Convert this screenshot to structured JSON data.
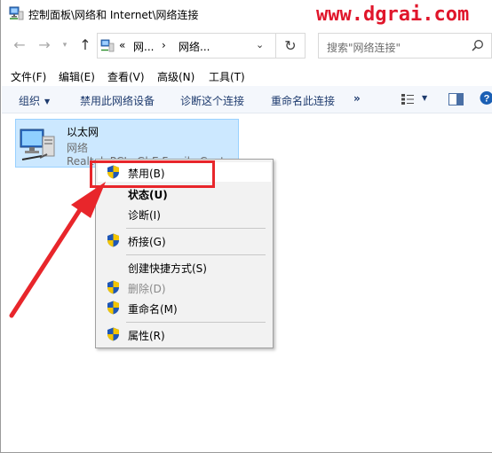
{
  "window": {
    "title": "控制面板\\网络和 Internet\\网络连接",
    "watermark": "www.dgrai.com"
  },
  "address": {
    "chevron_prefix": "«",
    "segment1": "网...",
    "separator": "›",
    "segment2": "网络...",
    "search_placeholder": "搜索\"网络连接\""
  },
  "menubar": {
    "items": [
      "文件(F)",
      "编辑(E)",
      "查看(V)",
      "高级(N)",
      "工具(T)"
    ]
  },
  "toolbar": {
    "organize": "组织",
    "disable": "禁用此网络设备",
    "diagnose": "诊断这个连接",
    "rename": "重命名此连接",
    "more": "»"
  },
  "network_item": {
    "name": "以太网",
    "status": "网络",
    "adapter": "Realtek PCIe GbE Family Cont..."
  },
  "context_menu": {
    "items": [
      {
        "label": "禁用(B)",
        "shield": true,
        "bold": false,
        "disabled": false
      },
      {
        "label": "状态(U)",
        "shield": false,
        "bold": true,
        "disabled": false
      },
      {
        "label": "诊断(I)",
        "shield": false,
        "bold": false,
        "disabled": false
      },
      {
        "label": "桥接(G)",
        "shield": true,
        "bold": false,
        "disabled": false
      },
      {
        "label": "创建快捷方式(S)",
        "shield": false,
        "bold": false,
        "disabled": false
      },
      {
        "label": "删除(D)",
        "shield": true,
        "bold": false,
        "disabled": true
      },
      {
        "label": "重命名(M)",
        "shield": true,
        "bold": false,
        "disabled": false
      },
      {
        "label": "属性(R)",
        "shield": true,
        "bold": false,
        "disabled": false
      }
    ]
  },
  "colors": {
    "accent_red": "#e8262b",
    "selection_bg": "#cce8ff",
    "toolbar_text": "#1e3b6e"
  }
}
